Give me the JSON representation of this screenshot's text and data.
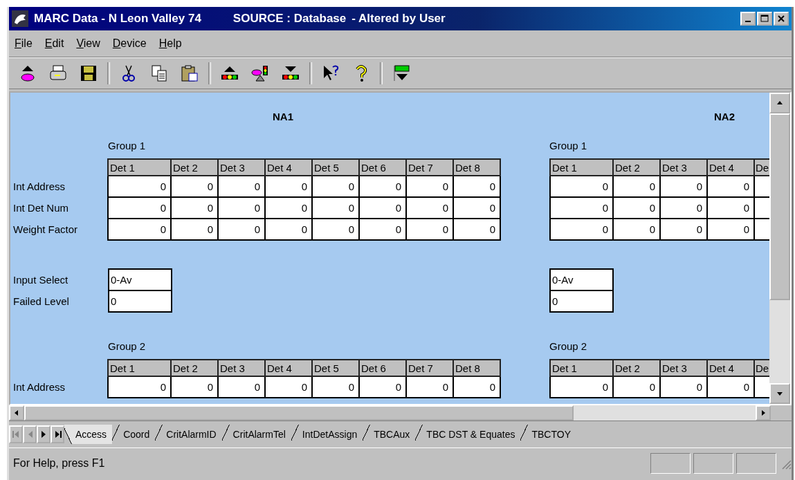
{
  "window": {
    "title": "MARC Data - N Leon Valley 74",
    "source": "SOURCE : Database",
    "note": "- Altered by User"
  },
  "menu": [
    "File",
    "Edit",
    "View",
    "Device",
    "Help"
  ],
  "panels": [
    {
      "title": "NA1",
      "groups": [
        {
          "label": "Group 1",
          "columns": [
            "Det 1",
            "Det 2",
            "Det 3",
            "Det 4",
            "Det 5",
            "Det 6",
            "Det 7",
            "Det 8"
          ],
          "rows": [
            {
              "label": "Int Address",
              "cells": [
                "0",
                "0",
                "0",
                "0",
                "0",
                "0",
                "0",
                "0"
              ]
            },
            {
              "label": "Int Det Num",
              "cells": [
                "0",
                "0",
                "0",
                "0",
                "0",
                "0",
                "0",
                "0"
              ]
            },
            {
              "label": "Weight Factor",
              "cells": [
                "0",
                "0",
                "0",
                "0",
                "0",
                "0",
                "0",
                "0"
              ]
            }
          ]
        },
        {
          "label": "Group 2",
          "columns": [
            "Det 1",
            "Det 2",
            "Det 3",
            "Det 4",
            "Det 5",
            "Det 6",
            "Det 7",
            "Det 8"
          ],
          "rows": [
            {
              "label": "Int Address",
              "cells": [
                "0",
                "0",
                "0",
                "0",
                "0",
                "0",
                "0",
                "0"
              ]
            }
          ]
        }
      ],
      "inputs": [
        {
          "label": "Input Select",
          "value": "0-Av"
        },
        {
          "label": "Failed Level",
          "value": "0"
        }
      ]
    },
    {
      "title": "NA2",
      "groups": [
        {
          "label": "Group 1",
          "columns": [
            "Det 1",
            "Det 2",
            "Det 3",
            "Det 4",
            "De"
          ],
          "rows": [
            {
              "cells": [
                "0",
                "0",
                "0",
                "0"
              ]
            },
            {
              "cells": [
                "0",
                "0",
                "0",
                "0"
              ]
            },
            {
              "cells": [
                "0",
                "0",
                "0",
                "0"
              ]
            }
          ]
        },
        {
          "label": "Group 2",
          "columns": [
            "Det 1",
            "Det 2",
            "Det 3",
            "Det 4",
            "De"
          ],
          "rows": [
            {
              "cells": [
                "0",
                "0",
                "0",
                "0"
              ]
            }
          ]
        }
      ],
      "inputs": [
        {
          "value": "0-Av"
        },
        {
          "value": "0"
        }
      ]
    }
  ],
  "tab_nav": [
    {
      "kind": "first",
      "disabled": true
    },
    {
      "kind": "prev",
      "disabled": true
    },
    {
      "kind": "next",
      "disabled": false
    },
    {
      "kind": "last",
      "disabled": false
    }
  ],
  "tabs": [
    {
      "label": "Access",
      "selected": true
    },
    {
      "label": "Coord",
      "selected": false
    },
    {
      "label": "CritAlarmID",
      "selected": false
    },
    {
      "label": "CritAlarmTel",
      "selected": false
    },
    {
      "label": "IntDetAssign",
      "selected": false
    },
    {
      "label": "TBCAux",
      "selected": false
    },
    {
      "label": "TBC DST & Equates",
      "selected": false
    },
    {
      "label": "TBCTOY",
      "selected": false
    }
  ],
  "status_bar": {
    "text": "For Help, press F1"
  }
}
